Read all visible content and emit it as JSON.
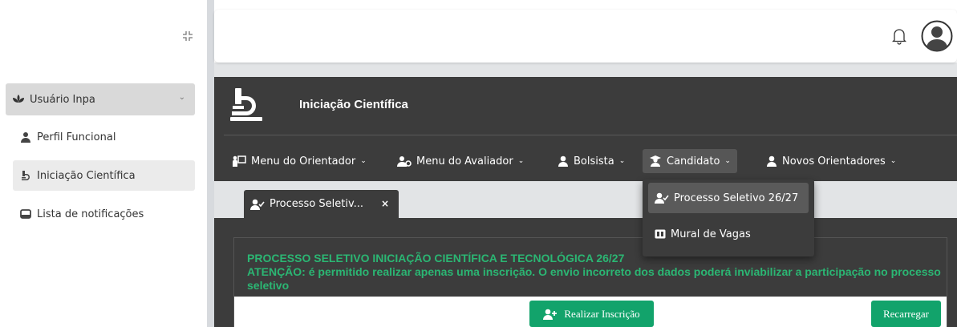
{
  "sidebar": {
    "group_label": "Usuário Inpa",
    "items": [
      {
        "label": "Perfil Funcional"
      },
      {
        "label": "Iniciação Científica"
      },
      {
        "label": "Lista de notificações"
      }
    ]
  },
  "header": {
    "module_title": "Iniciação Científica"
  },
  "nav": {
    "items": [
      {
        "label": "Menu do Orientador"
      },
      {
        "label": "Menu do Avaliador"
      },
      {
        "label": "Bolsista"
      },
      {
        "label": "Candidato"
      },
      {
        "label": "Novos Orientadores"
      }
    ],
    "dropdown": [
      {
        "label": "Processo Seletivo 26/27"
      },
      {
        "label": "Mural de Vagas"
      }
    ]
  },
  "tabs": [
    {
      "label": "Processo Seletiv...",
      "close": "×"
    }
  ],
  "content": {
    "title": "PROCESSO SELETIVO INICIAÇÃO CIENTÍFICA E TECNOLÓGICA 26/27",
    "warning": "ATENÇÃO: é permitido realizar apenas uma inscrição. O envio incorreto dos dados poderá inviabilizar a participação no processo seletivo",
    "register_button": "Realizar Inscrição",
    "reload_button": "Recarregar"
  },
  "colors": {
    "dark_bg": "#3c3c3c",
    "accent_green": "#2bb673",
    "button_green": "#12a36b"
  },
  "icons": {
    "collapse": "collapse-icon",
    "bell": "bell-icon",
    "avatar": "user-avatar-icon"
  }
}
